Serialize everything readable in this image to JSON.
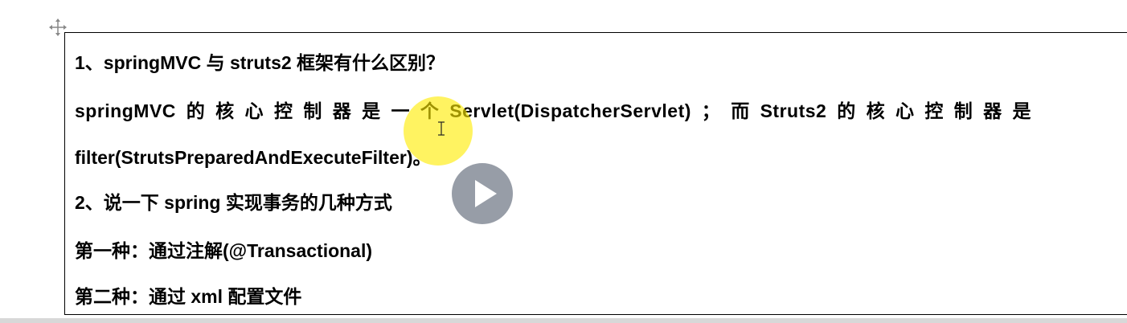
{
  "document": {
    "lines": [
      "1、springMVC 与 struts2 框架有什么区别？",
      "springMVC 的 核 心 控 制 器 是 一 个 Servlet(DispatcherServlet) ； 而 Struts2 的 核 心 控 制 器 是",
      "filter(StrutsPreparedAndExecuteFilter)。",
      "2、说一下 spring 实现事务的几种方式",
      "第一种：通过注解(@Transactional)",
      "第二种：通过 xml 配置文件"
    ]
  },
  "icons": {
    "table_move_handle": "move-cross-icon",
    "cursor": "ibeam-cursor-icon",
    "video_overlay": "play-icon"
  },
  "colors": {
    "text": "#000000",
    "cursor_highlight": "#ffeb00",
    "play_button_bg": "#808894"
  }
}
